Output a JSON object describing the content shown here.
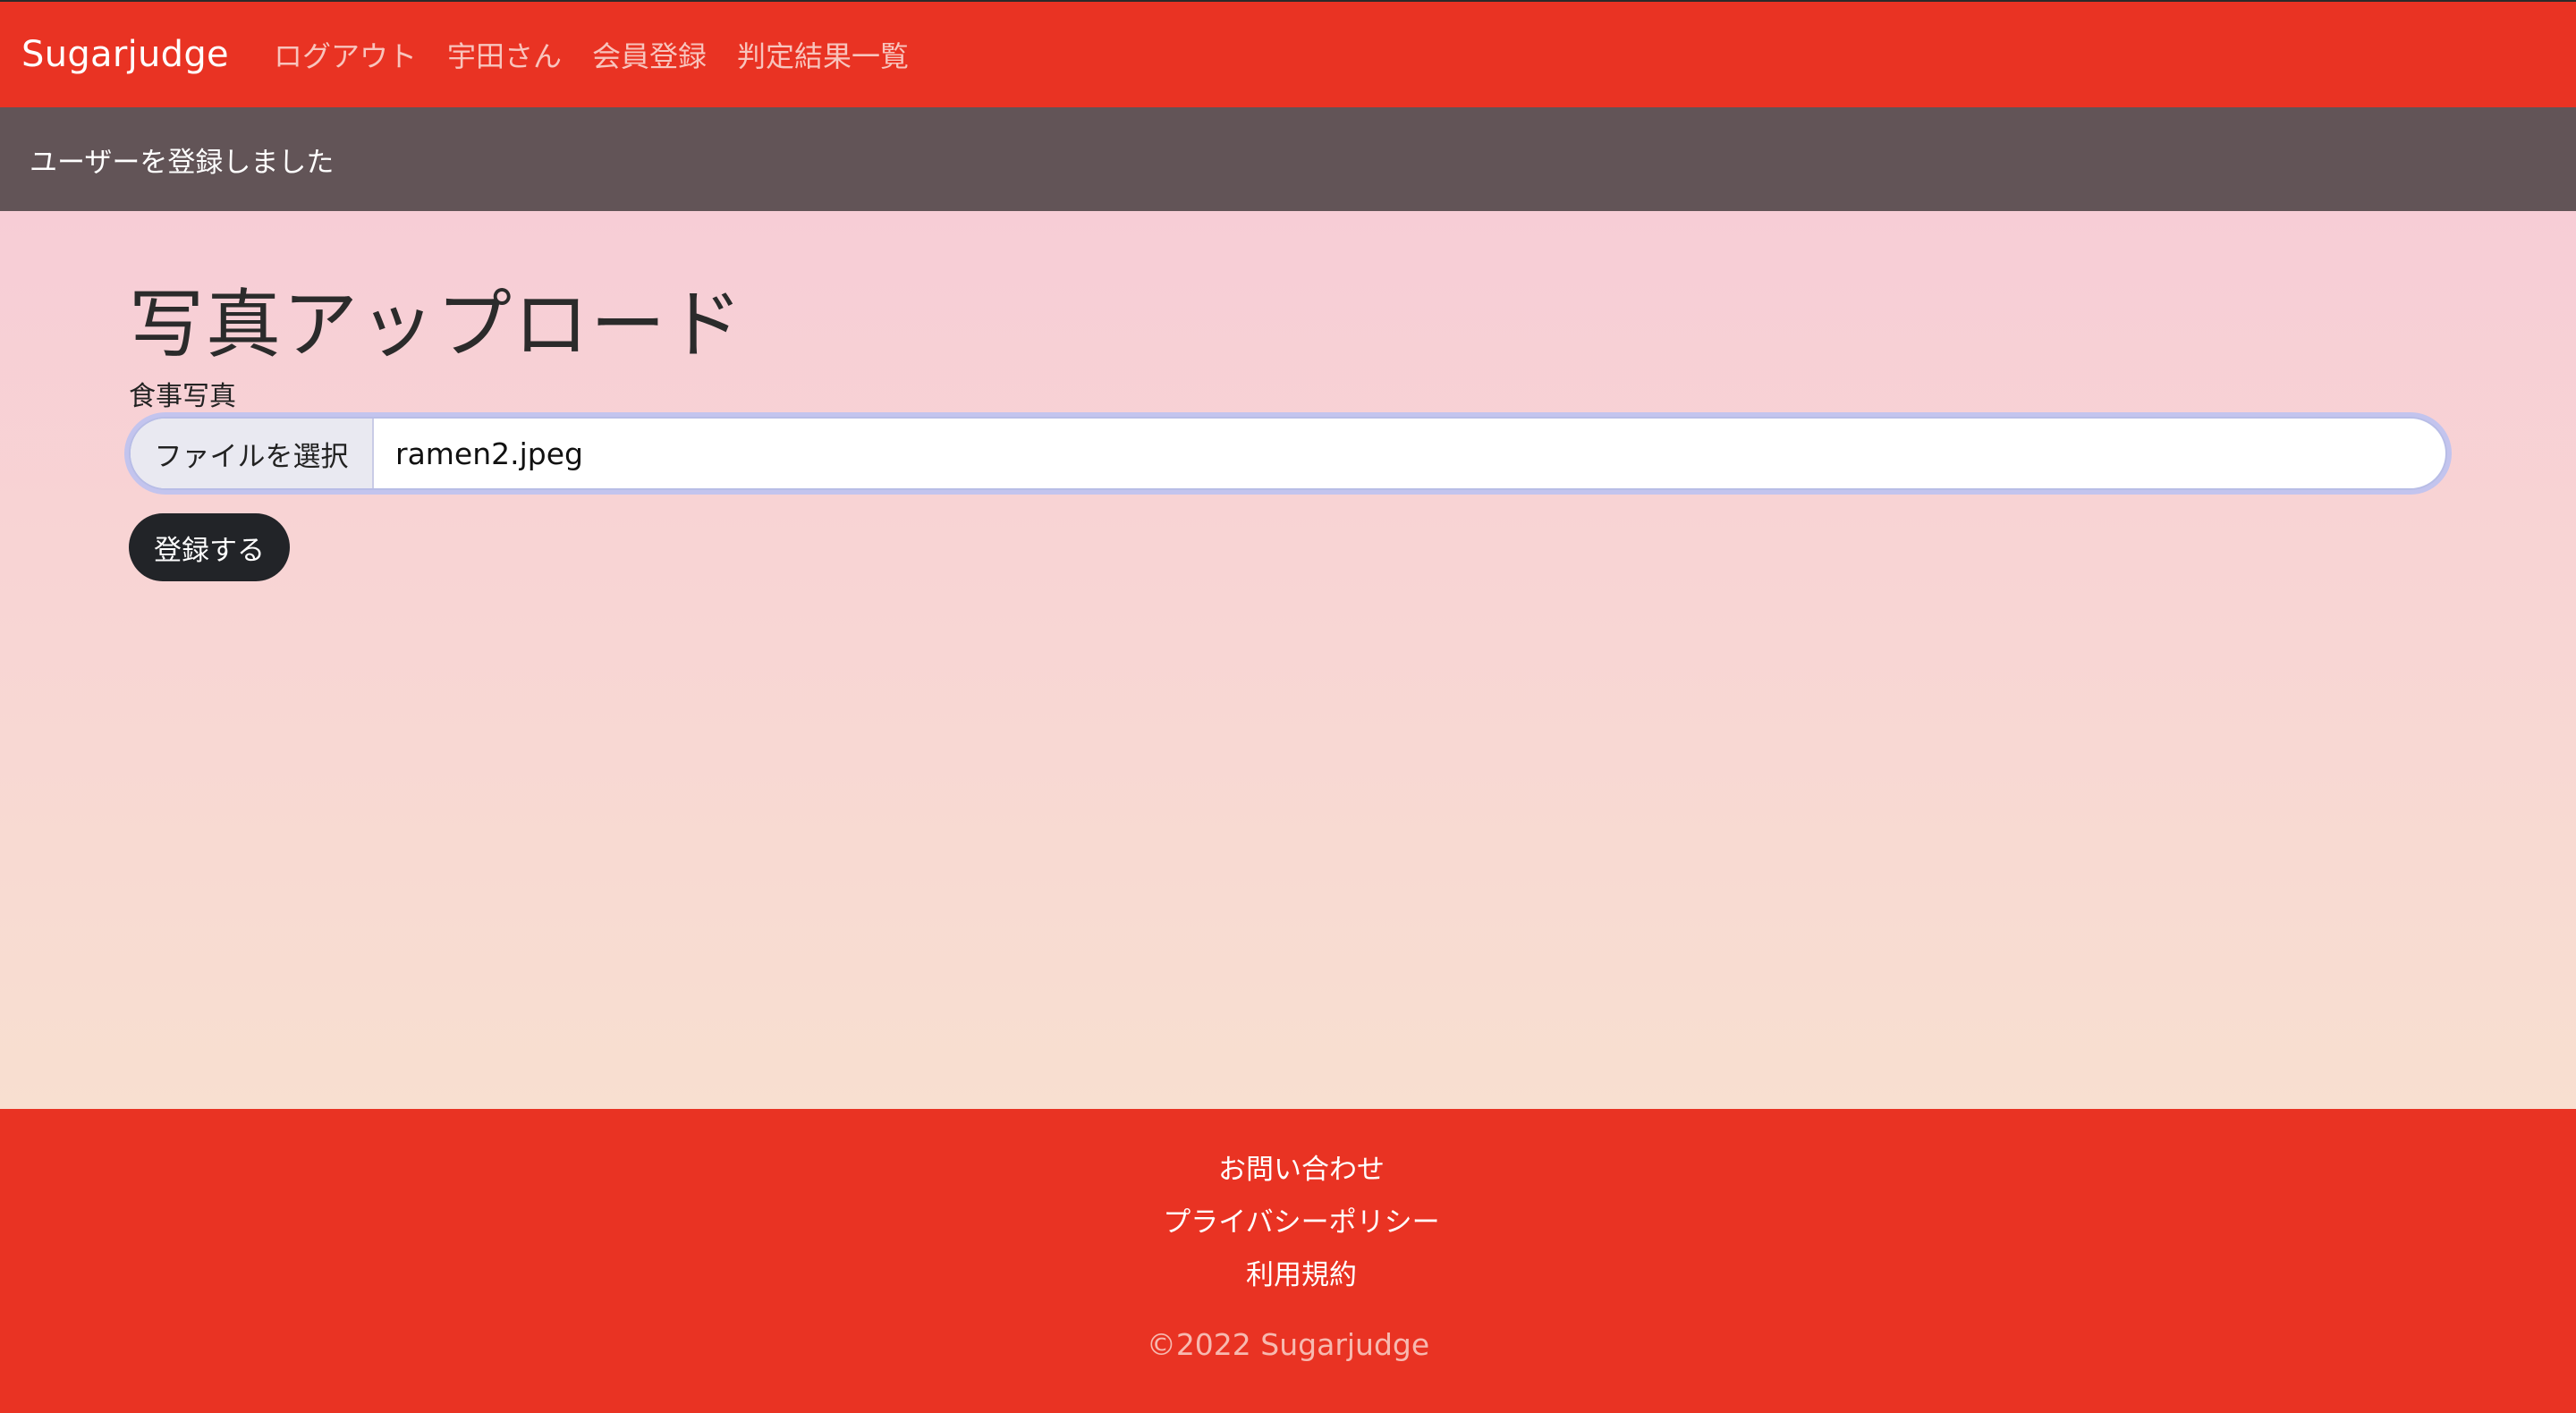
{
  "navbar": {
    "brand": "Sugarjudge",
    "links": [
      "ログアウト",
      "宇田さん",
      "会員登録",
      "判定結果一覧"
    ],
    "bg_color": "#e93323"
  },
  "flash": {
    "message": "ユーザーを登録しました",
    "bg_color": "#625457"
  },
  "main": {
    "title": "写真アップロード",
    "field_label": "食事写真",
    "file_button": "ファイルを選択",
    "file_name": "ramen2.jpeg",
    "submit": "登録する"
  },
  "footer": {
    "links": [
      "お問い合わせ",
      "プライバシーポリシー",
      "利用規約"
    ],
    "copyright": "©2022 Sugarjudge"
  }
}
